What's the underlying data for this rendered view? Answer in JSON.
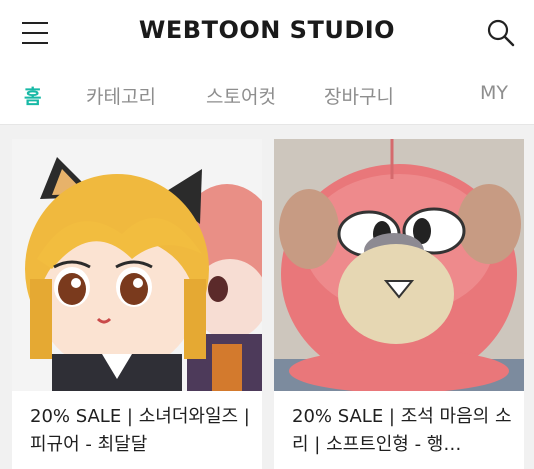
{
  "header": {
    "logo_text": "WEBTOON STUDIO"
  },
  "tabs": [
    {
      "label": "홈",
      "active": true
    },
    {
      "label": "카테고리",
      "active": false
    },
    {
      "label": "스토어컷",
      "active": false
    },
    {
      "label": "장바구니",
      "active": false
    },
    {
      "label": "MY",
      "active": false
    }
  ],
  "products": [
    {
      "title": "20% SALE | 소녀더와일즈 | 피규어 - 최달달"
    },
    {
      "title": "20% SALE | 조석 마음의 소리 | 소프트인형 - 행…"
    }
  ],
  "colors": {
    "accent": "#17b9a6",
    "tab_inactive": "#8e8e8e",
    "page_bg": "#f1f1f1"
  }
}
